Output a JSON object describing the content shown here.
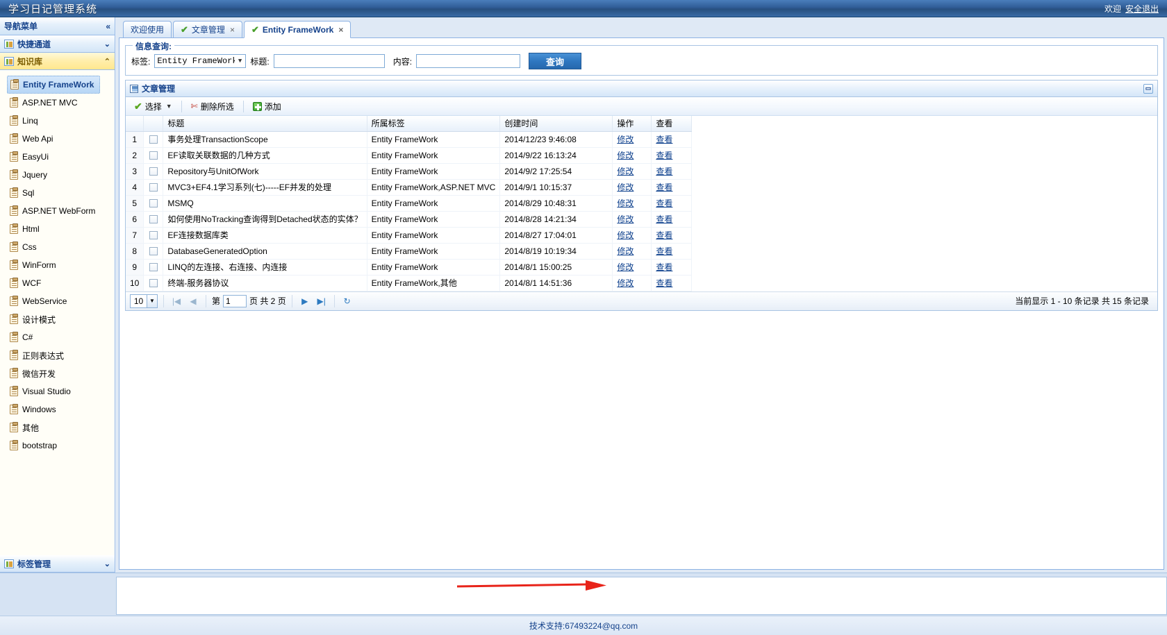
{
  "header": {
    "title": "学习日记管理系统",
    "welcome": "欢迎",
    "logout": "安全退出"
  },
  "sidebar": {
    "panel_title": "导航菜单",
    "collapse_icon": "«",
    "groups": [
      {
        "label": "快捷通道",
        "caret": "⌄",
        "state": "collapsed",
        "icon": "folder-icon"
      },
      {
        "label": "知识库",
        "caret": "⌃",
        "state": "active",
        "icon": "folder-icon"
      }
    ],
    "bottom_group": {
      "label": "标签管理",
      "caret": "⌄",
      "icon": "folder-icon"
    },
    "items": [
      {
        "label": "Entity FrameWork",
        "selected": true
      },
      {
        "label": "ASP.NET MVC",
        "selected": false
      },
      {
        "label": "Linq",
        "selected": false
      },
      {
        "label": "Web Api",
        "selected": false
      },
      {
        "label": "EasyUi",
        "selected": false
      },
      {
        "label": "Jquery",
        "selected": false
      },
      {
        "label": "Sql",
        "selected": false
      },
      {
        "label": "ASP.NET WebForm",
        "selected": false
      },
      {
        "label": "Html",
        "selected": false
      },
      {
        "label": "Css",
        "selected": false
      },
      {
        "label": "WinForm",
        "selected": false
      },
      {
        "label": "WCF",
        "selected": false
      },
      {
        "label": "WebService",
        "selected": false
      },
      {
        "label": "设计模式",
        "selected": false
      },
      {
        "label": "C#",
        "selected": false
      },
      {
        "label": "正则表达式",
        "selected": false
      },
      {
        "label": "微信开发",
        "selected": false
      },
      {
        "label": "Visual Studio",
        "selected": false
      },
      {
        "label": "Windows",
        "selected": false
      },
      {
        "label": "其他",
        "selected": false
      },
      {
        "label": "bootstrap",
        "selected": false
      }
    ]
  },
  "tabs": [
    {
      "label": "欢迎使用",
      "active": false,
      "closable": false,
      "has_check": false
    },
    {
      "label": "文章管理",
      "active": false,
      "closable": true,
      "has_check": true
    },
    {
      "label": "Entity FrameWork",
      "active": true,
      "closable": true,
      "has_check": true
    }
  ],
  "search": {
    "legend": "信息查询:",
    "tag_label": "标签:",
    "tag_value": "Entity FrameWork",
    "title_label": "标题:",
    "title_value": "",
    "content_label": "内容:",
    "content_value": "",
    "query_button": "查询"
  },
  "grid": {
    "panel_title": "文章管理",
    "toolbar": {
      "select_label": "选择",
      "delete_label": "删除所选",
      "add_label": "添加"
    },
    "columns": [
      "",
      "",
      "标题",
      "所属标签",
      "创建时间",
      "操作",
      "查看"
    ],
    "rows": [
      {
        "no": "1",
        "title": "事务处理TransactionScope",
        "tag": "Entity FrameWork",
        "created": "2014/12/23 9:46:08",
        "edit": "修改",
        "view": "查看"
      },
      {
        "no": "2",
        "title": "EF读取关联数据的几种方式",
        "tag": "Entity FrameWork",
        "created": "2014/9/22 16:13:24",
        "edit": "修改",
        "view": "查看"
      },
      {
        "no": "3",
        "title": "Repository与UnitOfWork",
        "tag": "Entity FrameWork",
        "created": "2014/9/2 17:25:54",
        "edit": "修改",
        "view": "查看"
      },
      {
        "no": "4",
        "title": "MVC3+EF4.1学习系列(七)-----EF并发的处理",
        "tag": "Entity FrameWork,ASP.NET MVC",
        "created": "2014/9/1 10:15:37",
        "edit": "修改",
        "view": "查看"
      },
      {
        "no": "5",
        "title": "MSMQ",
        "tag": "Entity FrameWork",
        "created": "2014/8/29 10:48:31",
        "edit": "修改",
        "view": "查看"
      },
      {
        "no": "6",
        "title": "如何使用NoTracking查询得到Detached状态的实体？",
        "tag": "Entity FrameWork",
        "created": "2014/8/28 14:21:34",
        "edit": "修改",
        "view": "查看"
      },
      {
        "no": "7",
        "title": "EF连接数据库类",
        "tag": "Entity FrameWork",
        "created": "2014/8/27 17:04:01",
        "edit": "修改",
        "view": "查看"
      },
      {
        "no": "8",
        "title": "DatabaseGeneratedOption",
        "tag": "Entity FrameWork",
        "created": "2014/8/19 10:19:34",
        "edit": "修改",
        "view": "查看"
      },
      {
        "no": "9",
        "title": "LINQ的左连接、右连接、内连接",
        "tag": "Entity FrameWork",
        "created": "2014/8/1 15:00:25",
        "edit": "修改",
        "view": "查看"
      },
      {
        "no": "10",
        "title": "终端-服务器协议",
        "tag": "Entity FrameWork,其他",
        "created": "2014/8/1 14:51:36",
        "edit": "修改",
        "view": "查看"
      }
    ]
  },
  "pager": {
    "page_size": "10",
    "first_icon": "|◀",
    "prev_icon": "◀",
    "page_prefix": "第",
    "page_value": "1",
    "page_suffix": "页 共 2 页",
    "next_icon": "▶",
    "last_icon": "▶|",
    "refresh_icon": "↻",
    "info": "当前显示 1 - 10 条记录 共 15 条记录"
  },
  "footer": {
    "text": "技术支持:67493224@qq.com"
  },
  "colors": {
    "header_blue": "#2f5c96",
    "accent_blue": "#15428b",
    "active_yellow": "#ffe78f",
    "link": "#0b3e8c",
    "arrow_red": "#e8241a",
    "button_blue": "#2f77c0"
  }
}
